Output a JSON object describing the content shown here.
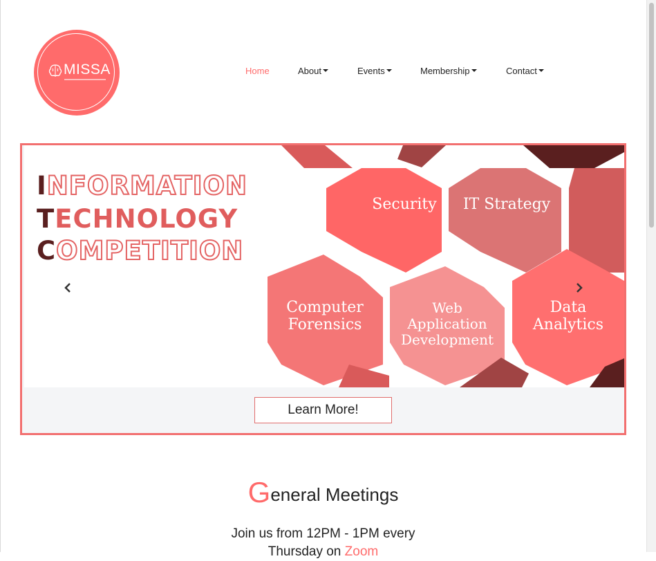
{
  "logo": {
    "text": "MISSA"
  },
  "nav": {
    "home": "Home",
    "about": "About",
    "events": "Events",
    "membership": "Membership",
    "contact": "Contact"
  },
  "carousel": {
    "headline": {
      "line1": {
        "first": "I",
        "rest": "NFORMATION"
      },
      "line2": {
        "first": "T",
        "rest": "ECHNOLOGY"
      },
      "line3": {
        "first": "C",
        "rest": "OMPETITION"
      }
    },
    "hexes": {
      "security": "Security",
      "it_strategy": "IT Strategy",
      "forensics": "Computer Forensics",
      "webdev": "Web Application Development",
      "analytics": "Data Analytics"
    },
    "learn_more": "Learn More!"
  },
  "meetings": {
    "title_cap": "G",
    "title_rest": "eneral Meetings",
    "line1": "Join us from 12PM - 1PM every",
    "line2_prefix": "Thursday on ",
    "line2_link": "Zoom"
  },
  "colors": {
    "accent": "#ff6b6b",
    "border": "#f26f6f",
    "hex_coral": "#ff6666",
    "hex_rose": "#db7474",
    "hex_light": "#f59292",
    "hex_dark": "#8a3535",
    "hex_darkest": "#5a1f1f"
  }
}
